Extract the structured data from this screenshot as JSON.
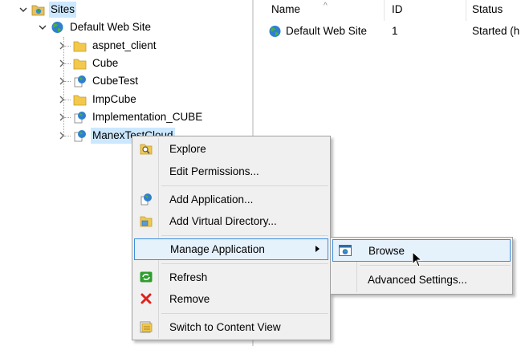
{
  "tree": {
    "sites_label": "Sites",
    "default_site_label": "Default Web Site",
    "children": [
      {
        "label": "aspnet_client",
        "icon": "folder-icon"
      },
      {
        "label": "Cube",
        "icon": "folder-icon"
      },
      {
        "label": "CubeTest",
        "icon": "web-application-icon"
      },
      {
        "label": "ImpCube",
        "icon": "folder-icon"
      },
      {
        "label": "Implementation_CUBE",
        "icon": "web-application-icon"
      },
      {
        "label": "ManexTestCloud",
        "icon": "web-application-icon"
      }
    ]
  },
  "list": {
    "columns": [
      "Name",
      "ID",
      "Status"
    ],
    "row": {
      "name": "Default Web Site",
      "id": "1",
      "status": "Started (h"
    }
  },
  "context_menu": {
    "items": [
      {
        "label": "Explore",
        "icon": "explore-icon"
      },
      {
        "label": "Edit Permissions...",
        "icon": ""
      },
      {
        "label": "Add Application...",
        "icon": "add-application-icon"
      },
      {
        "label": "Add Virtual Directory...",
        "icon": "add-virtual-directory-icon"
      },
      {
        "label": "Manage Application",
        "icon": "",
        "highlighted": true,
        "has_submenu": true
      },
      {
        "label": "Refresh",
        "icon": "refresh-icon"
      },
      {
        "label": "Remove",
        "icon": "remove-icon"
      },
      {
        "label": "Switch to Content View",
        "icon": "content-view-icon"
      }
    ]
  },
  "submenu": {
    "items": [
      {
        "label": "Browse",
        "icon": "browse-icon",
        "highlighted": true
      },
      {
        "label": "Advanced Settings...",
        "icon": ""
      }
    ]
  },
  "colors": {
    "selection": "#cce8ff",
    "menu_background": "#f0f0f0",
    "menu_highlight": "#e5f1fb",
    "menu_highlight_border": "#3d8ee0",
    "remove_red": "#e0201b",
    "refresh_green": "#2e9e2e"
  }
}
